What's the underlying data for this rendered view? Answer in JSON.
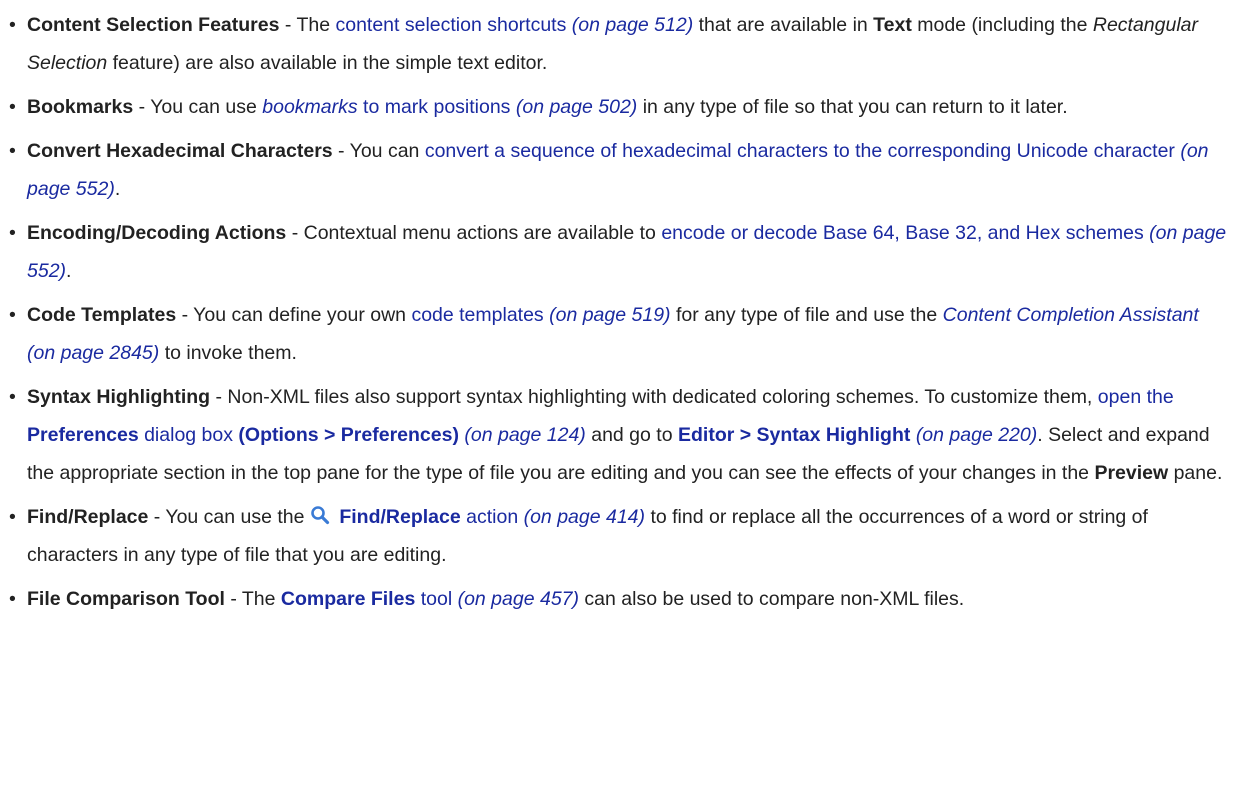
{
  "items": [
    {
      "label": "Content Selection Features",
      "t1": " - The ",
      "link": "content selection shortcuts",
      "page": "(on page 512)",
      "t2": " that are available in ",
      "strong": "Text",
      "t3": " mode (including the ",
      "italic": "Rectangular Selection",
      "t4": " feature) are also available in the simple text editor."
    },
    {
      "label": "Bookmarks",
      "t1": " - You can use ",
      "italic_link": "bookmarks",
      "link": " to mark positions",
      "page": "(on page 502)",
      "t2": " in any type of file so that you can return to it later."
    },
    {
      "label": "Convert Hexadecimal Characters",
      "t1": " - You can ",
      "link": "convert a sequence of hexadecimal characters to the corresponding Unicode character",
      "page": "(on page 552)",
      "t2": "."
    },
    {
      "label": "Encoding/Decoding Actions",
      "t1": " - Contextual menu actions are available to ",
      "link": "encode or decode Base 64, Base 32, and Hex schemes",
      "page": "(on page 552)",
      "t2": "."
    },
    {
      "label": "Code Templates",
      "t1": " - You can define your own ",
      "link": "code templates",
      "page": "(on page 519)",
      "t2": " for any type of file and use the ",
      "italic_link": "Content Completion Assistant (on page 2845)",
      "t3": " to invoke them."
    },
    {
      "label": "Syntax Highlighting",
      "t1": " - Non-XML files also support syntax highlighting with dedicated coloring schemes. To customize them, ",
      "link1": "open the ",
      "link1_bold": "Preferences",
      "link1_b": " dialog box ",
      "link1_bold2": "(Options > Preferences)",
      "page1": "(on page 124)",
      "t2": " and go to ",
      "link2_bold": "Editor > Syntax Highlight",
      "page2": "(on page 220)",
      "t3": ". Select and expand the appropriate section in the top pane for the type of file you are editing and you can see the effects of your changes in the ",
      "strong": "Preview",
      "t4": " pane."
    },
    {
      "label": "Find/Replace",
      "t1": " - You can use the ",
      "icon": "search-icon",
      "link_bold": "Find/Replace",
      "link": " action",
      "page": "(on page 414)",
      "t2": " to find or replace all the occurrences of a word or string of characters in any type of file that you are editing."
    },
    {
      "label": "File Comparison Tool",
      "t1": " - The ",
      "link_bold": "Compare Files",
      "link": " tool",
      "page": "(on page 457)",
      "t2": " can also be used to compare non-XML files."
    }
  ],
  "colors": {
    "link": "#1a2aa0",
    "text": "#222222",
    "icon": "#3a7bd5"
  }
}
